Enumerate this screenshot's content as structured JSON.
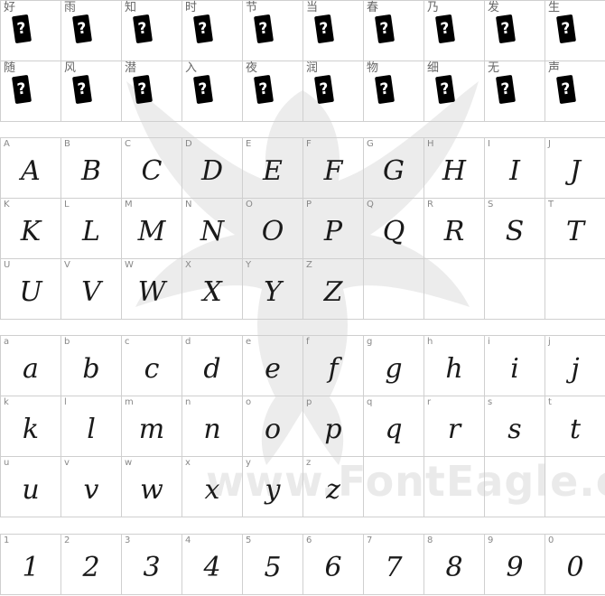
{
  "watermark": {
    "text": "www.FontEagle.com"
  },
  "sections": {
    "cjk": {
      "missing_glyph": "?",
      "rows": [
        [
          "好",
          "雨",
          "知",
          "时",
          "节",
          "当",
          "春",
          "乃",
          "发",
          "生"
        ],
        [
          "随",
          "风",
          "潜",
          "入",
          "夜",
          "润",
          "物",
          "细",
          "无",
          "声"
        ]
      ]
    },
    "upper": {
      "rows": [
        [
          "A",
          "B",
          "C",
          "D",
          "E",
          "F",
          "G",
          "H",
          "I",
          "J"
        ],
        [
          "K",
          "L",
          "M",
          "N",
          "O",
          "P",
          "Q",
          "R",
          "S",
          "T"
        ],
        [
          "U",
          "V",
          "W",
          "X",
          "Y",
          "Z",
          "",
          "",
          "",
          ""
        ]
      ]
    },
    "lower": {
      "rows": [
        [
          "a",
          "b",
          "c",
          "d",
          "e",
          "f",
          "g",
          "h",
          "i",
          "j"
        ],
        [
          "k",
          "l",
          "m",
          "n",
          "o",
          "p",
          "q",
          "r",
          "s",
          "t"
        ],
        [
          "u",
          "v",
          "w",
          "x",
          "y",
          "z",
          "",
          "",
          "",
          ""
        ]
      ]
    },
    "digits": {
      "rows": [
        [
          "1",
          "2",
          "3",
          "4",
          "5",
          "6",
          "7",
          "8",
          "9",
          "0"
        ]
      ]
    }
  }
}
